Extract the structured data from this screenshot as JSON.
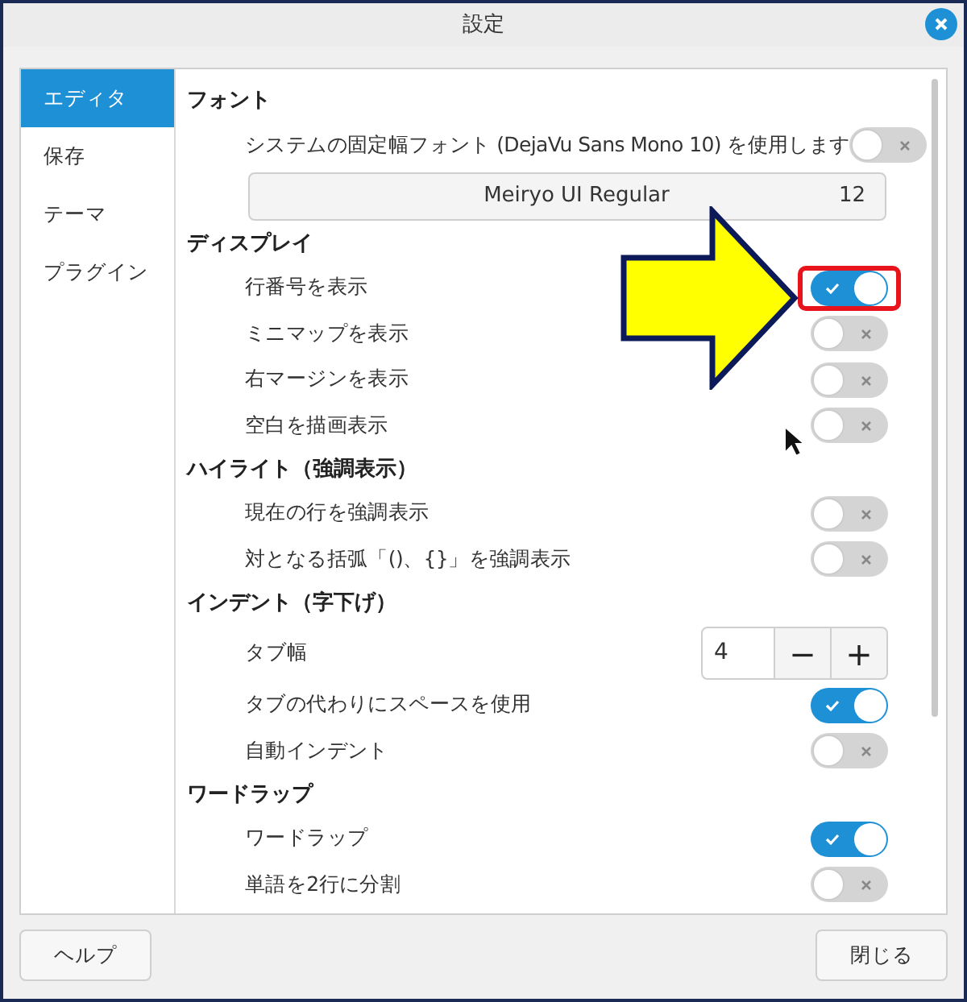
{
  "window": {
    "title": "設定"
  },
  "sidebar": {
    "items": [
      {
        "label": "エディタ",
        "selected": true
      },
      {
        "label": "保存",
        "selected": false
      },
      {
        "label": "テーマ",
        "selected": false
      },
      {
        "label": "プラグイン",
        "selected": false
      }
    ]
  },
  "sections": [
    {
      "heading": "フォント",
      "items": [
        {
          "kind": "toggle",
          "label": "システムの固定幅フォント (DejaVu Sans Mono 10) を使用します",
          "on": false
        },
        {
          "kind": "font_button",
          "label": "Meiryo UI Regular",
          "size": "12"
        }
      ]
    },
    {
      "heading": "ディスプレイ",
      "items": [
        {
          "kind": "toggle",
          "label": "行番号を表示",
          "on": true,
          "highlighted": true
        },
        {
          "kind": "toggle",
          "label": "ミニマップを表示",
          "on": false
        },
        {
          "kind": "toggle",
          "label": "右マージンを表示",
          "on": false
        },
        {
          "kind": "toggle",
          "label": "空白を描画表示",
          "on": false
        }
      ]
    },
    {
      "heading": "ハイライト（強調表示）",
      "items": [
        {
          "kind": "toggle",
          "label": "現在の行を強調表示",
          "on": false
        },
        {
          "kind": "toggle",
          "label": "対となる括弧「()、{}」を強調表示",
          "on": false
        }
      ]
    },
    {
      "heading": "インデント（字下げ）",
      "items": [
        {
          "kind": "spinner",
          "label": "タブ幅",
          "value": "4",
          "minus": "−",
          "plus": "+"
        },
        {
          "kind": "toggle",
          "label": "タブの代わりにスペースを使用",
          "on": true
        },
        {
          "kind": "toggle",
          "label": "自動インデント",
          "on": false
        }
      ]
    },
    {
      "heading": "ワードラップ",
      "items": [
        {
          "kind": "toggle",
          "label": "ワードラップ",
          "on": true
        },
        {
          "kind": "toggle",
          "label": "単語を2行に分割",
          "on": false
        }
      ]
    }
  ],
  "buttons": {
    "help": "ヘルプ",
    "close": "閉じる"
  }
}
